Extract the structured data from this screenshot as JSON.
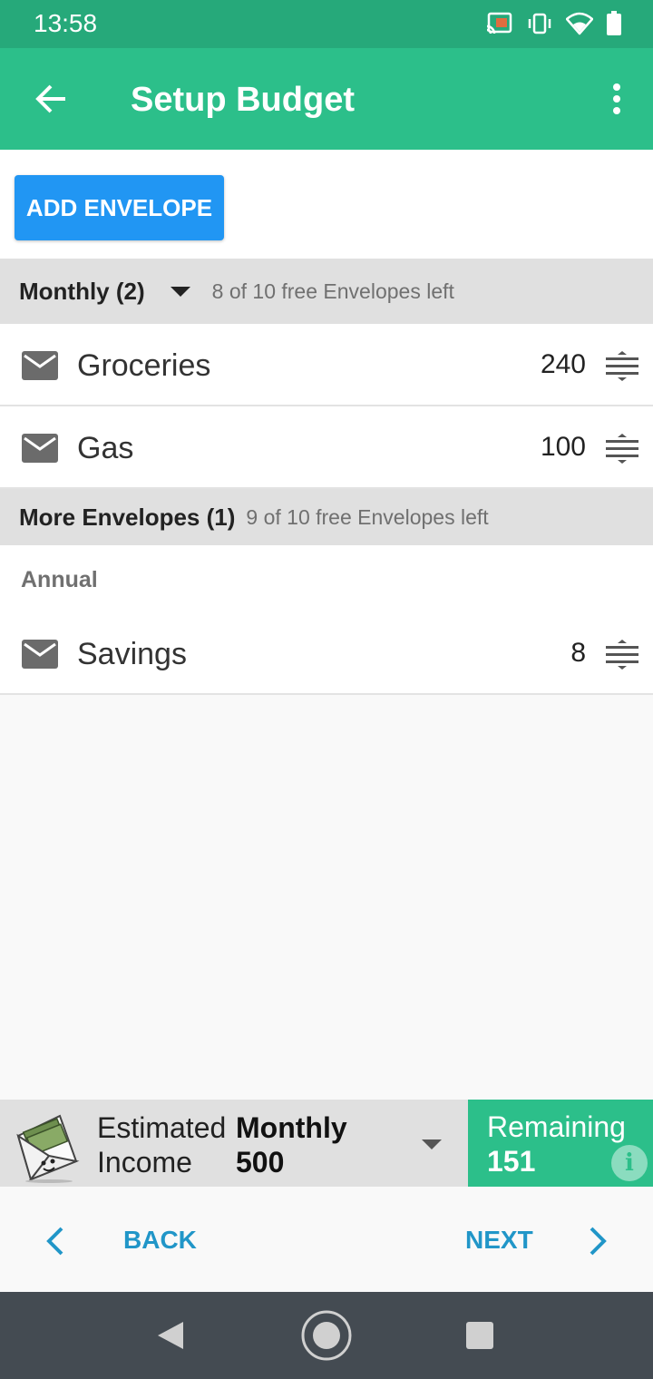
{
  "status_bar": {
    "time": "13:58",
    "icons": [
      "cast-icon",
      "vibrate-icon",
      "wifi-icon",
      "battery-icon"
    ]
  },
  "app_bar": {
    "title": "Setup Budget",
    "back_icon": "arrow-back-icon",
    "menu_icon": "more-vert-icon"
  },
  "toolbar": {
    "add_envelope_label": "ADD ENVELOPE"
  },
  "sections": [
    {
      "name": "Monthly (2)",
      "note": "8 of 10 free Envelopes left",
      "items": [
        {
          "label": "Groceries",
          "amount": "240"
        },
        {
          "label": "Gas",
          "amount": "100"
        }
      ]
    },
    {
      "name": "More Envelopes (1)",
      "note": "9 of 10 free Envelopes left",
      "subheader": "Annual",
      "items": [
        {
          "label": "Savings",
          "amount": "8"
        }
      ]
    }
  ],
  "footer": {
    "estimated_label_1": "Estimated",
    "estimated_label_2": "Income",
    "period": "Monthly",
    "income_value": "500",
    "remaining_label": "Remaining",
    "remaining_value": "151",
    "info_icon_glyph": "i"
  },
  "navigation": {
    "back_label": "BACK",
    "next_label": "NEXT"
  },
  "colors": {
    "status_bar": "#26a97a",
    "app_bar": "#2cbf8a",
    "primary_button": "#2196f3",
    "link": "#2196c8",
    "section_header": "#e0e0e0",
    "system_nav": "#444b52"
  }
}
